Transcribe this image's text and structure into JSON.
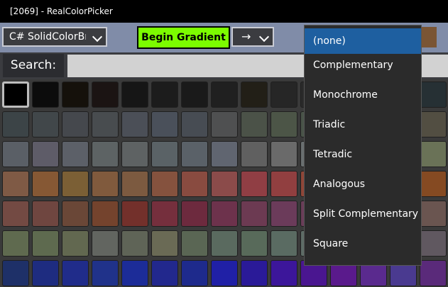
{
  "window": {
    "title": "[2069] - RealColorPicker"
  },
  "toolbar": {
    "format_combo": "C# SolidColorBrush",
    "begin_gradient": "Begin Gradient",
    "arrow_combo": "→",
    "swatch_color": "#7a5534"
  },
  "search": {
    "label": "Search:",
    "value": "",
    "placeholder": ""
  },
  "dropdown": {
    "items": [
      "(none)",
      "Complementary",
      "Monochrome",
      "Triadic",
      "Tetradic",
      "Analogous",
      "Split Complementary",
      "Square"
    ],
    "selected_index": 0,
    "selected_color": "#1e5fa0"
  },
  "colors": {
    "rows": [
      [
        "#000000",
        "#0c0c0c",
        "#15110b",
        "#1b1413",
        "#161616",
        "#1c1c1c",
        "#1a1a1a",
        "#202020",
        "#221f17",
        "#262626",
        "#2a2a2a",
        "#2c2c2c",
        "#262b2c",
        "#2a2f31",
        "#263034"
      ],
      [
        "#3c4447",
        "#41474a",
        "#45484d",
        "#484c4f",
        "#4b4f57",
        "#4a505a",
        "#474c53",
        "#4f5051",
        "#4b5248",
        "#4c5547",
        "#4a5449",
        "#525057",
        "#4c5756",
        "#515c58",
        "#524e42"
      ],
      [
        "#5a5f66",
        "#5e5c68",
        "#5c6068",
        "#5d6364",
        "#5e6263",
        "#5a6266",
        "#5a6168",
        "#606570",
        "#606060",
        "#6a6a6a",
        "#6a6f70",
        "#6c6b6e",
        "#6d7077",
        "#707a66",
        "#6a7257"
      ],
      [
        "#7f5a45",
        "#865834",
        "#7b5f35",
        "#805a3d",
        "#7c5a40",
        "#85523e",
        "#894b40",
        "#8b4b4a",
        "#903e44",
        "#913f40",
        "#8f4638",
        "#874b38",
        "#7f4f3a",
        "#7d4a2e",
        "#854a22"
      ],
      [
        "#734a43",
        "#6f4640",
        "#6a4737",
        "#74432d",
        "#73302b",
        "#752f3d",
        "#6d2a3e",
        "#6d324c",
        "#6c3a52",
        "#6b3b5a",
        "#6a3d58",
        "#6e4a55",
        "#6c525a",
        "#6d5868",
        "#6a5550"
      ],
      [
        "#5f6a4f",
        "#5e6a4f",
        "#626850",
        "#626560",
        "#5f6457",
        "#6a6a55",
        "#5a6654",
        "#5a6a5f",
        "#586a5a",
        "#5a6b62",
        "#5e6c66",
        "#62665e",
        "#5c5c5a",
        "#5a5860",
        "#605860"
      ],
      [
        "#1e3068",
        "#1e2c80",
        "#202c8a",
        "#20328a",
        "#1c2c98",
        "#22288d",
        "#1e2a8c",
        "#2020a6",
        "#2a1a98",
        "#3c169a",
        "#4a1690",
        "#5a1a8c",
        "#5a2a8e",
        "#4a3a90",
        "#5a2a7a"
      ]
    ]
  }
}
